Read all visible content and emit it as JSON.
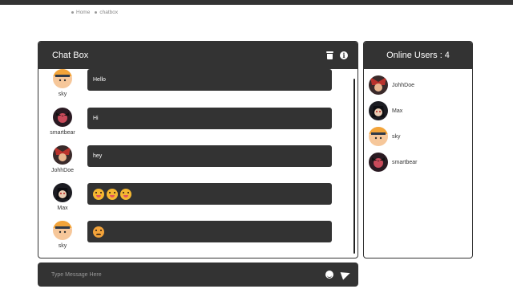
{
  "breadcrumb": {
    "home": "Home",
    "current": "chatbox"
  },
  "chat": {
    "title": "Chat Box",
    "messages": [
      {
        "user": "sky",
        "avatar": "naruto-avatar",
        "text": "Hello"
      },
      {
        "user": "smartbear",
        "avatar": "dark-anime-avatar",
        "text": "Hi"
      },
      {
        "user": "JohhDoe",
        "avatar": "red-hair-avatar",
        "text": "hey"
      },
      {
        "user": "Max",
        "avatar": "itachi-avatar",
        "text": "",
        "emojis": [
          "tongue-emoji",
          "tongue-emoji",
          "tongue-emoji"
        ]
      },
      {
        "user": "sky",
        "avatar": "naruto-avatar",
        "text": "",
        "emojis": [
          "angry-emoji"
        ]
      }
    ]
  },
  "composer": {
    "placeholder": "Type Message Here"
  },
  "online": {
    "title": "Online Users : 4",
    "users": [
      "JohhDoe",
      "Max",
      "sky",
      "smartbear"
    ]
  },
  "colors": {
    "dark": "#333333",
    "emoji": "#f5b731"
  }
}
